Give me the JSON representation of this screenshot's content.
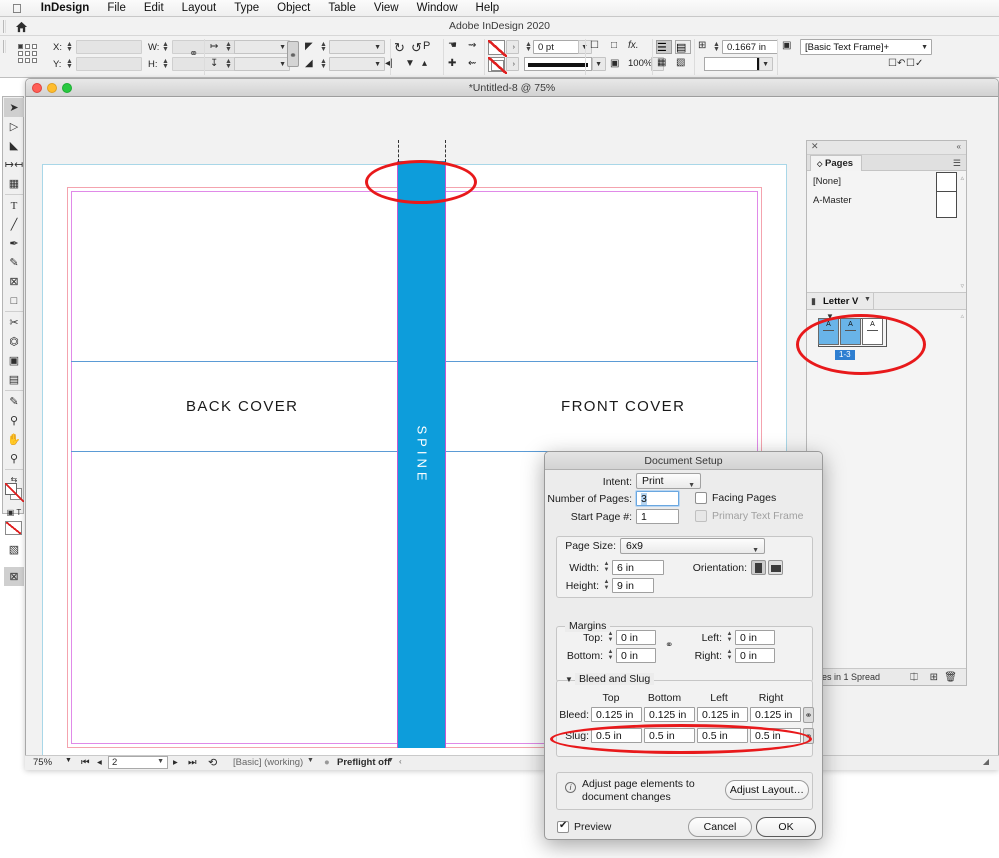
{
  "menubar": {
    "apple_icon": "apple-icon",
    "items": [
      {
        "label": "InDesign",
        "bold": true
      },
      {
        "label": "File",
        "bold": false
      },
      {
        "label": "Edit",
        "bold": false
      },
      {
        "label": "Layout",
        "bold": false
      },
      {
        "label": "Type",
        "bold": false
      },
      {
        "label": "Object",
        "bold": false
      },
      {
        "label": "Table",
        "bold": false
      },
      {
        "label": "View",
        "bold": false
      },
      {
        "label": "Window",
        "bold": false
      },
      {
        "label": "Help",
        "bold": false
      }
    ]
  },
  "app": {
    "title": "Adobe InDesign 2020",
    "home_icon": "home-icon"
  },
  "control_bar": {
    "x_label": "X:",
    "y_label": "Y:",
    "w_label": "W:",
    "h_label": "H:",
    "x_value": "",
    "y_value": "",
    "w_value": "",
    "h_value": "",
    "scale_x_value": "",
    "scale_y_value": "",
    "rotate_value": "",
    "shear_value": "",
    "stroke_weight": "0 pt",
    "opacity": "100%",
    "text_inset": "0.1667 in",
    "object_style": "[Basic Text Frame]+",
    "constrain_icon": "chain-link-icon",
    "rotate_cw_icon": "rotate-clockwise-icon",
    "rotate_ccw_icon": "rotate-counterclockwise-icon",
    "flip_icon": "flip-icon",
    "fx_label": "fx.",
    "p_label": "P"
  },
  "document_window": {
    "title": "*Untitled-8 @ 75%",
    "traffic_lights": [
      "close-button",
      "minimize-button",
      "zoom-button"
    ]
  },
  "canvas": {
    "back_cover_label": "BACK COVER",
    "front_cover_label": "FRONT COVER",
    "spine_label": "SPINE",
    "spine_color": "#0d9ddb",
    "slug_guide_color": "#a9d7e8",
    "bleed_guide_color": "#f4a3ae",
    "page_edge_color": "#e08ae8",
    "margin_guide_color": "#5b9bd5",
    "annotation_color": "#e8191b"
  },
  "pages_panel": {
    "tab_label": "Pages",
    "close_icon": "close-icon",
    "collapse_icon": "collapse-icon",
    "menu_icon": "panel-menu-icon",
    "masters": [
      {
        "label": "[None]"
      },
      {
        "label": "A-Master"
      }
    ],
    "page_size_label": "Letter V",
    "page_thumbs": [
      {
        "master": "A",
        "selected": true
      },
      {
        "master": "A",
        "selected": true
      },
      {
        "master": "A",
        "selected": false
      }
    ],
    "page_range_badge": "1-3",
    "footer_text": "ages in 1 Spread",
    "footer_icons": [
      "edit-page-size-icon",
      "new-page-icon",
      "delete-page-icon"
    ]
  },
  "status_bar": {
    "zoom": "75%",
    "page_number": "2",
    "first_icon": "first-page-icon",
    "prev_icon": "previous-page-icon",
    "next_icon": "next-page-icon",
    "last_icon": "last-page-icon",
    "workspace": "[Basic] (working)",
    "preflight": "Preflight off"
  },
  "dialog": {
    "title": "Document Setup",
    "intent_label": "Intent:",
    "intent_value": "Print",
    "number_of_pages_label": "Number of Pages:",
    "number_of_pages_value": "3",
    "start_page_label": "Start Page #:",
    "start_page_value": "1",
    "facing_pages_label": "Facing Pages",
    "facing_pages_checked": false,
    "primary_text_frame_label": "Primary Text Frame",
    "primary_text_frame_checked": false,
    "primary_text_frame_disabled": true,
    "page_size_label": "Page Size:",
    "page_size_value": "6x9",
    "width_label": "Width:",
    "width_value": "6 in",
    "height_label": "Height:",
    "height_value": "9 in",
    "orientation_label": "Orientation:",
    "orientation_portrait_icon": "portrait-icon",
    "orientation_landscape_icon": "landscape-icon",
    "margins_group_label": "Margins",
    "margin_top_label": "Top:",
    "margin_top_value": "0 in",
    "margin_bottom_label": "Bottom:",
    "margin_bottom_value": "0 in",
    "margin_left_label": "Left:",
    "margin_left_value": "0 in",
    "margin_right_label": "Right:",
    "margin_right_value": "0 in",
    "margins_link_icon": "chain-link-broken-icon",
    "bleed_slug_group_label": "Bleed and Slug",
    "col_top": "Top",
    "col_bottom": "Bottom",
    "col_left": "Left",
    "col_right": "Right",
    "bleed_label": "Bleed:",
    "bleed_top": "0.125 in",
    "bleed_bottom": "0.125 in",
    "bleed_left": "0.125 in",
    "bleed_right": "0.125 in",
    "bleed_link_icon": "chain-link-icon",
    "slug_label": "Slug:",
    "slug_top": "0.5 in",
    "slug_bottom": "0.5 in",
    "slug_left": "0.5 in",
    "slug_right": "0.5 in",
    "slug_link_icon": "chain-link-icon",
    "adjust_info_text": "Adjust page elements to document changes",
    "adjust_layout_button": "Adjust Layout…",
    "info_icon": "info-icon",
    "preview_label": "Preview",
    "preview_checked": true,
    "cancel_button": "Cancel",
    "ok_button": "OK"
  },
  "toolbox": {
    "tools": [
      {
        "name": "selection-tool",
        "glyph": "➤",
        "active": true
      },
      {
        "name": "direct-selection-tool",
        "glyph": "➣",
        "active": false
      },
      {
        "name": "page-tool",
        "glyph": "◺",
        "active": false
      },
      {
        "name": "gap-tool",
        "glyph": "↔",
        "active": false
      },
      {
        "name": "content-collector-tool",
        "glyph": "▣",
        "active": false
      },
      {
        "name": "type-tool",
        "glyph": "T",
        "active": false
      },
      {
        "name": "line-tool",
        "glyph": "╱",
        "active": false
      },
      {
        "name": "pen-tool",
        "glyph": "✒",
        "active": false
      },
      {
        "name": "pencil-tool",
        "glyph": "✎",
        "active": false
      },
      {
        "name": "frame-tool",
        "glyph": "⊠",
        "active": false
      },
      {
        "name": "rectangle-tool",
        "glyph": "▢",
        "active": false
      },
      {
        "name": "scissors-tool",
        "glyph": "✂",
        "active": false
      },
      {
        "name": "free-transform-tool",
        "glyph": "⛶",
        "active": false
      },
      {
        "name": "gradient-swatch-tool",
        "glyph": "▤",
        "active": false
      },
      {
        "name": "gradient-feather-tool",
        "glyph": "▦",
        "active": false
      },
      {
        "name": "note-tool",
        "glyph": "▤",
        "active": false
      },
      {
        "name": "eyedropper-tool",
        "glyph": "⚲",
        "active": false
      },
      {
        "name": "hand-tool",
        "glyph": "✋",
        "active": false
      },
      {
        "name": "zoom-tool",
        "glyph": "🔍",
        "active": false
      }
    ],
    "fill_stroke_icon": "fill-stroke-swatches",
    "formatting_text_icon": "formatting-affects-text-icon",
    "apply_none_icon": "apply-none-icon",
    "normal_view_icon": "normal-view-mode-icon",
    "preview_view_icon": "preview-mode-icon"
  }
}
